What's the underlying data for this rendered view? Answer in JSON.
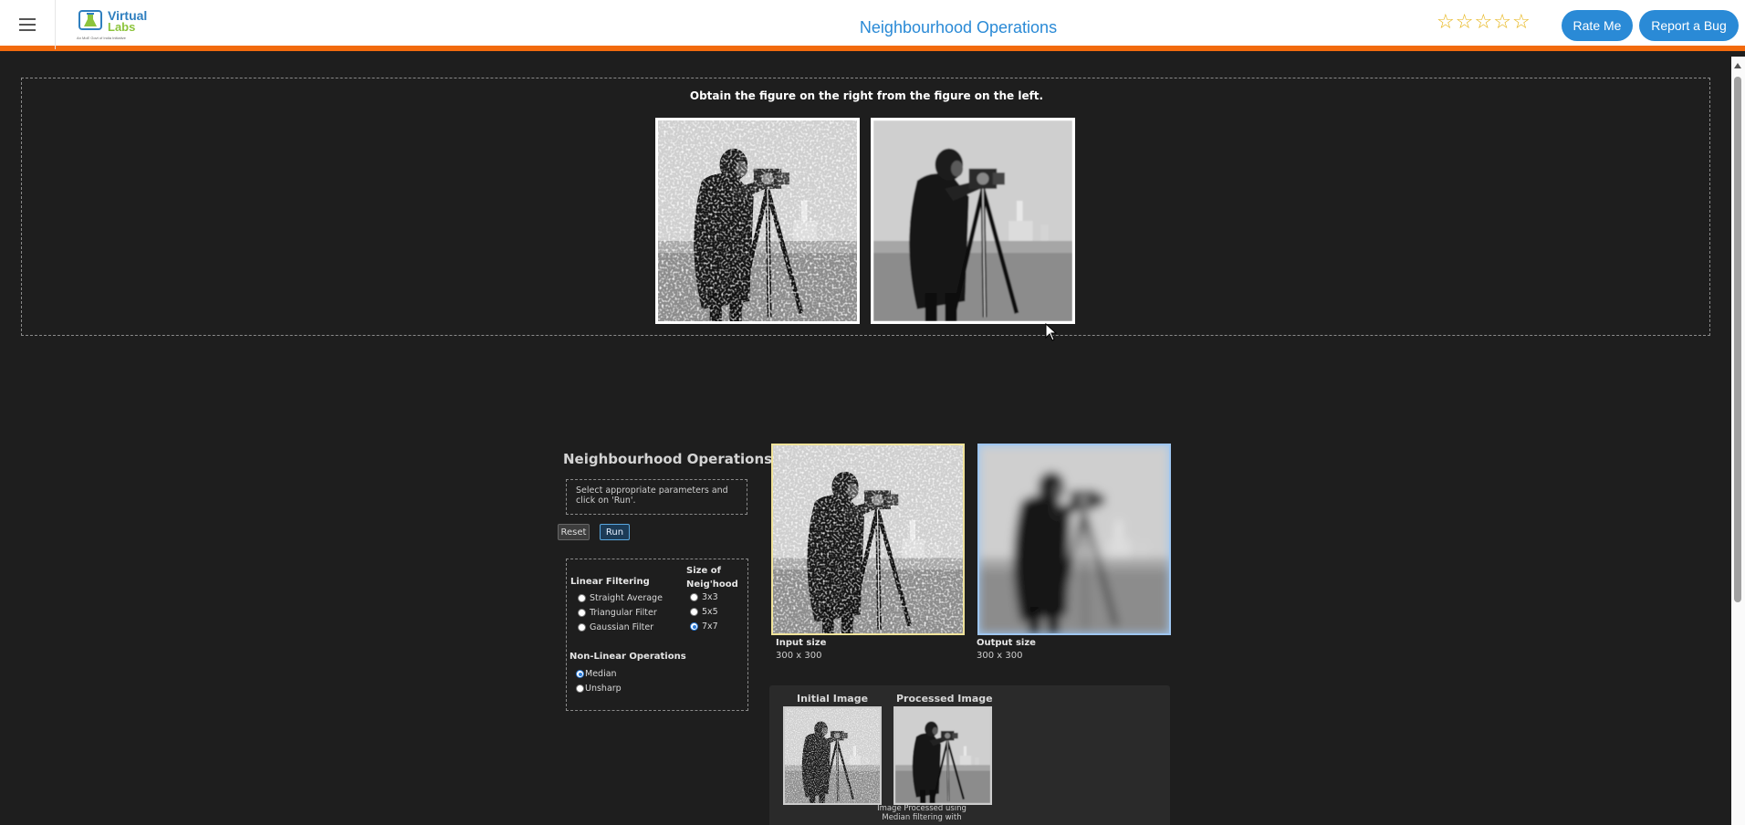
{
  "header": {
    "logo_line1": "Virtual",
    "logo_line2": "Labs",
    "logo_tagline": "An MoE Govt of India Initiative",
    "title": "Neighbourhood Operations",
    "rating_stars": 5,
    "rate_label": "Rate Me",
    "bug_label": "Report a Bug"
  },
  "question": {
    "text": "Obtain the figure on the right from the figure on the left."
  },
  "experiment": {
    "title": "Neighbourhood Operations",
    "instructions": "Select appropriate parameters and click on 'Run'.",
    "reset_label": "Reset",
    "run_label": "Run",
    "linear_heading": "Linear Filtering",
    "linear_options": [
      "Straight Average",
      "Triangular Filter",
      "Gaussian Filter"
    ],
    "size_heading_1": "Size of",
    "size_heading_2": "Neig'hood",
    "size_options": [
      "3x3",
      "5x5",
      "7x7"
    ],
    "size_selected": "7x7",
    "nonlinear_heading": "Non-Linear Operations",
    "nonlinear_options": [
      "Median",
      "Unsharp"
    ],
    "nonlinear_selected": "Median",
    "input_size_label": "Input size",
    "input_size_value": "300 x 300",
    "output_size_label": "Output size",
    "output_size_value": "300 x 300",
    "history_initial_label": "Initial Image",
    "history_processed_label": "Processed Image",
    "history_caption": "Image Processed using Median filtering with"
  },
  "colors": {
    "accent_blue": "#2a8ad6",
    "header_border_orange": "#f26a0d",
    "star_yellow": "#e7b416",
    "background": "#1e1e1e"
  }
}
